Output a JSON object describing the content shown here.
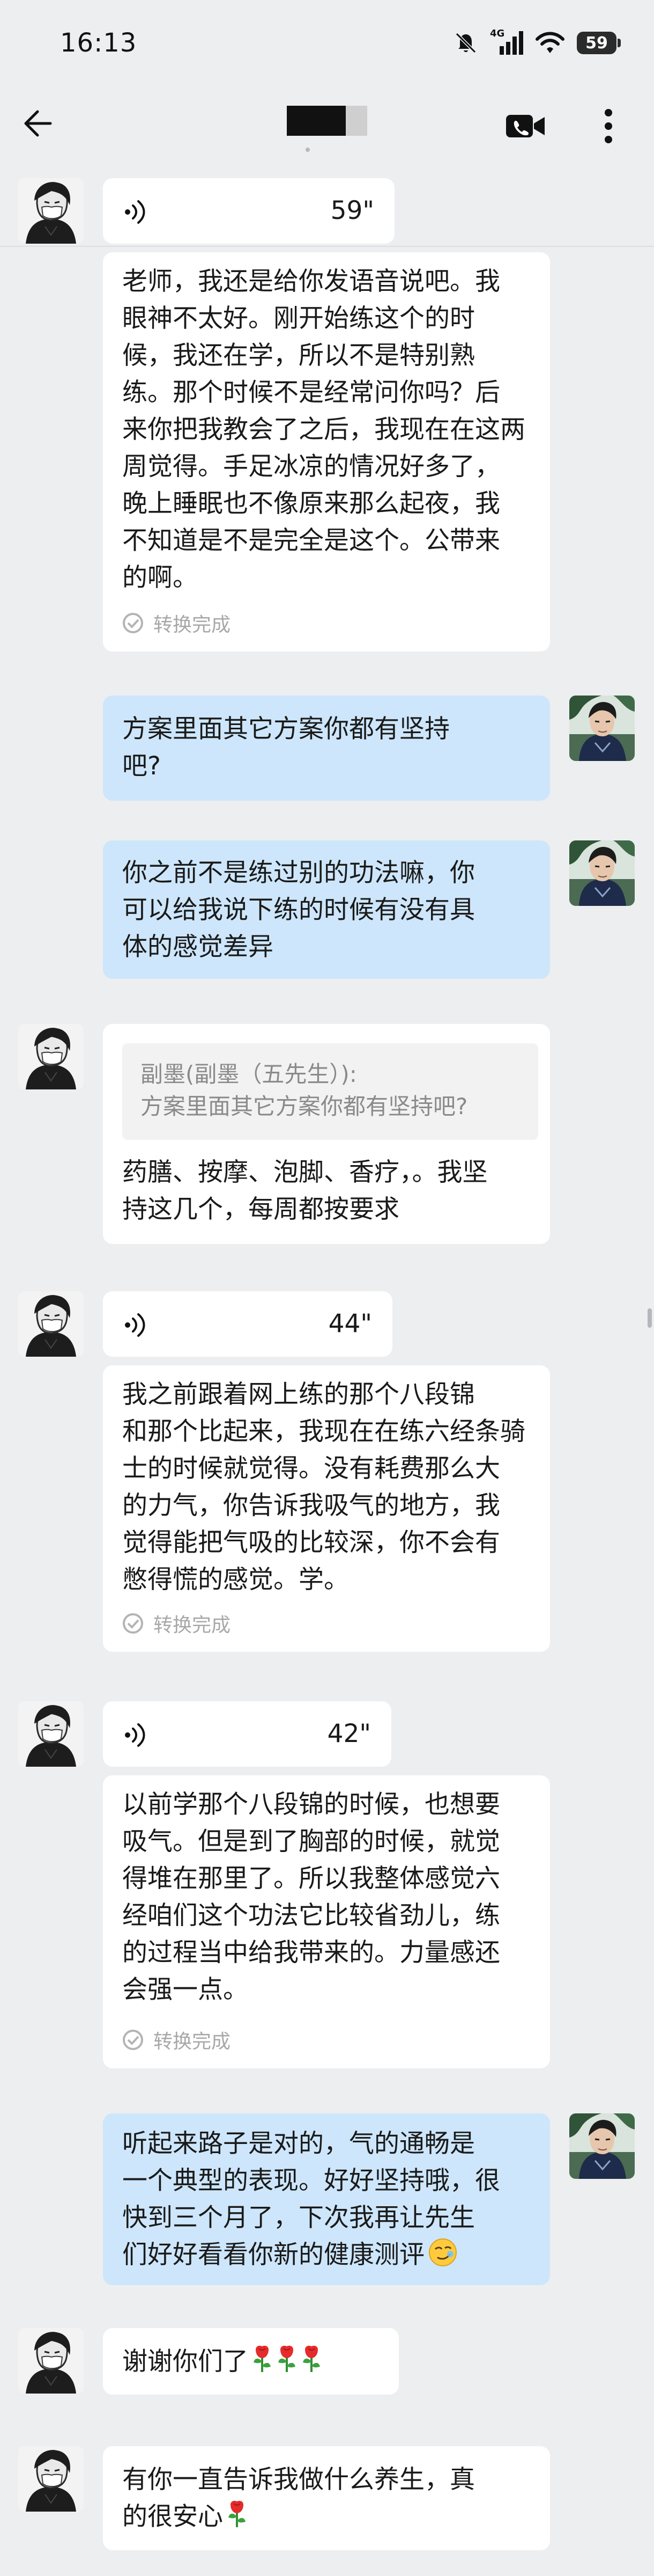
{
  "status_bar": {
    "time": "16:13",
    "network": "4G",
    "battery": "59"
  },
  "header": {
    "title_visible": false,
    "icons": [
      "back-arrow-icon",
      "video-call-icon",
      "more-vertical-icon"
    ]
  },
  "messages": [
    {
      "sender": "contact",
      "type": "voice",
      "duration": "59\"",
      "transcript_lines": [
        "老师，我还是给你发语音说吧。我",
        "眼神不太好。刚开始练这个的时",
        "候，我还在学，所以不是特别熟",
        "练。那个时候不是经常问你吗？后",
        "来你把我教会了之后，我现在在这两",
        "周觉得。手足冰凉的情况好多了，",
        "晚上睡眠也不像原来那么起夜，我",
        "不知道是不是完全是这个。公带来",
        "的啊。"
      ],
      "transcript_status": "转换完成"
    },
    {
      "sender": "me",
      "type": "text",
      "lines": [
        "方案里面其它方案你都有坚持",
        "吧?"
      ]
    },
    {
      "sender": "me",
      "type": "text",
      "lines": [
        "你之前不是练过别的功法嘛，你",
        "可以给我说下练的时候有没有具",
        "体的感觉差异"
      ]
    },
    {
      "sender": "contact",
      "type": "quote",
      "quote_author": "副墨(副墨（五先生）):",
      "quote_text": "方案里面其它方案你都有坚持吧?",
      "reply_lines": [
        "药膳、按摩、泡脚、香疗，。我坚",
        "持这几个，每周都按要求"
      ]
    },
    {
      "sender": "contact",
      "type": "voice",
      "duration": "44\"",
      "transcript_lines": [
        "我之前跟着网上练的那个八段锦",
        "和那个比起来，我现在在练六经条骑",
        "士的时候就觉得。没有耗费那么大",
        "的力气，你告诉我吸气的地方，我",
        "觉得能把气吸的比较深，你不会有",
        "憋得慌的感觉。学。"
      ],
      "transcript_status": "转换完成"
    },
    {
      "sender": "contact",
      "type": "voice",
      "duration": "42\"",
      "transcript_lines": [
        "以前学那个八段锦的时候，也想要",
        "吸气。但是到了胸部的时候，就觉",
        "得堆在那里了。所以我整体感觉六",
        "经咱们这个功法它比较省劲儿，练",
        "的过程当中给我带来的。力量感还",
        "会强一点。"
      ],
      "transcript_status": "转换完成"
    },
    {
      "sender": "me",
      "type": "text",
      "lines": [
        "听起来路子是对的，气的通畅是",
        "一个典型的表现。好好坚持哦，很",
        "快到三个月了，下次我再让先生",
        "们好好看看你新的健康测评"
      ],
      "trailing_emoji": "smirk-emoji"
    },
    {
      "sender": "contact",
      "type": "text",
      "lines": [
        "谢谢你们了"
      ],
      "trailing_emoji": "rose-emoji",
      "emoji_count": 3
    },
    {
      "sender": "contact",
      "type": "text",
      "lines": [
        "有你一直告诉我做什么养生，真",
        "的很安心"
      ],
      "trailing_emoji": "rose-emoji",
      "emoji_count": 1
    }
  ],
  "colors": {
    "background": "#edeef0",
    "left_bubble": "#ffffff",
    "right_bubble": "#cde6fb",
    "muted_text": "#a8a8a8"
  }
}
